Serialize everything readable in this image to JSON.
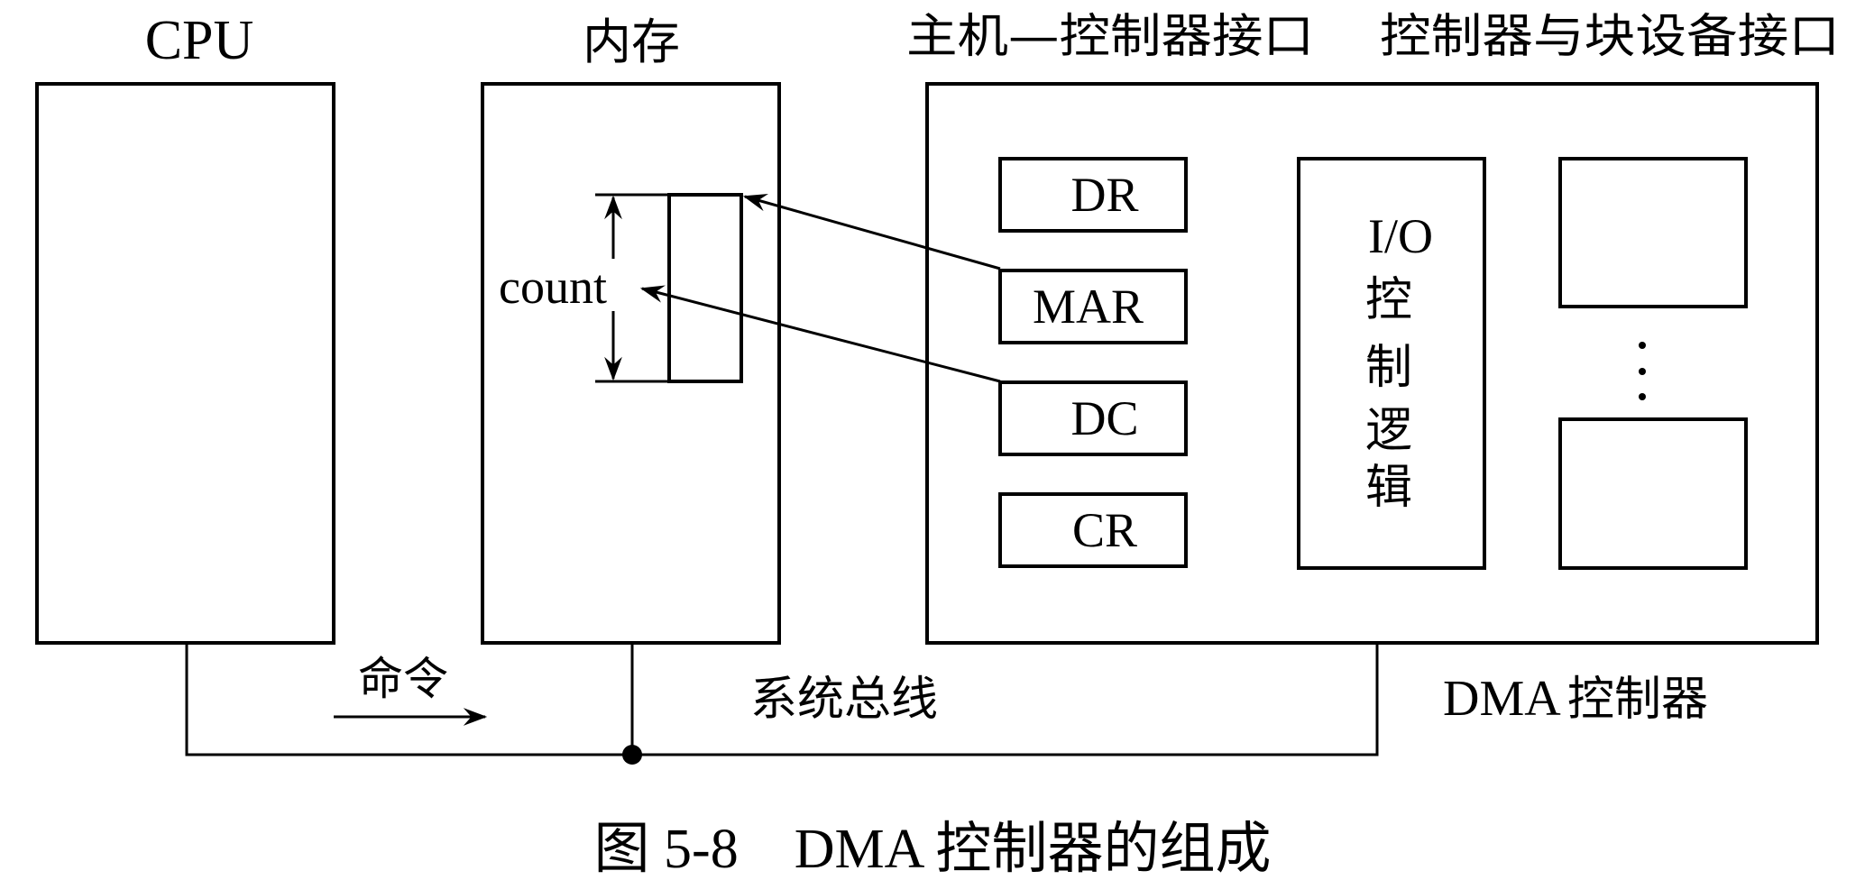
{
  "diagram": {
    "cpu_label": "CPU",
    "memory_label": "内存",
    "host_interface_label": "主机—控制器接口",
    "device_interface_label": "控制器与块设备接口",
    "count_label": "count",
    "registers": {
      "dr": "DR",
      "mar": "MAR",
      "dc": "DC",
      "cr": "CR"
    },
    "io_logic": {
      "line1": "I/O",
      "line2": "控",
      "line3": "制",
      "line4": "逻",
      "line5": "辑"
    },
    "ellipsis": "⋮",
    "command_label": "命令",
    "system_bus_label": "系统总线",
    "dma_label": "DMA",
    "controller_label": "控制器",
    "caption": "图 5-8　DMA 控制器的组成"
  }
}
